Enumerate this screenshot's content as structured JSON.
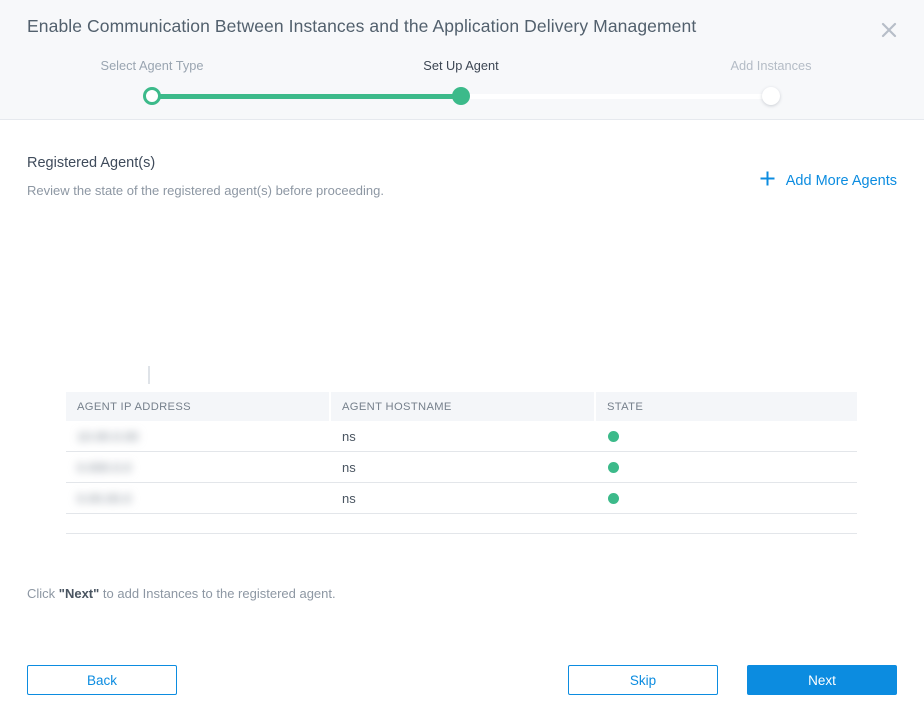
{
  "header": {
    "title": "Enable Communication Between Instances and the Application Delivery Management",
    "close_icon": "close-icon"
  },
  "stepper": {
    "steps": [
      {
        "label": "Select Agent Type",
        "state": "done"
      },
      {
        "label": "Set Up Agent",
        "state": "active"
      },
      {
        "label": "Add Instances",
        "state": "todo"
      }
    ],
    "progress_color": "#3cba8a",
    "track_color": "#ffffff"
  },
  "main": {
    "section_title": "Registered Agent(s)",
    "section_subtitle": "Review the state of the registered agent(s) before proceeding.",
    "add_more_agents": "Add More Agents",
    "add_more_agents_icon": "plus-icon",
    "link_color": "#0c8ce0"
  },
  "table": {
    "columns": [
      "AGENT IP ADDRESS",
      "AGENT HOSTNAME",
      "STATE"
    ],
    "rows": [
      {
        "ip": "10.00.0.00",
        "ip_redacted": true,
        "hostname": "ns",
        "state": "up",
        "state_color": "#3cba8a"
      },
      {
        "ip": "0.000.0.0",
        "ip_redacted": true,
        "hostname": "ns",
        "state": "up",
        "state_color": "#3cba8a"
      },
      {
        "ip": "0.00.00.0",
        "ip_redacted": true,
        "hostname": "ns",
        "state": "up",
        "state_color": "#3cba8a"
      }
    ]
  },
  "hint": {
    "prefix": "Click ",
    "emphasis": "\"Next\"",
    "suffix": " to add Instances to the registered agent."
  },
  "footer": {
    "back_label": "Back",
    "skip_label": "Skip",
    "next_label": "Next",
    "primary_color": "#0c8ce0"
  }
}
